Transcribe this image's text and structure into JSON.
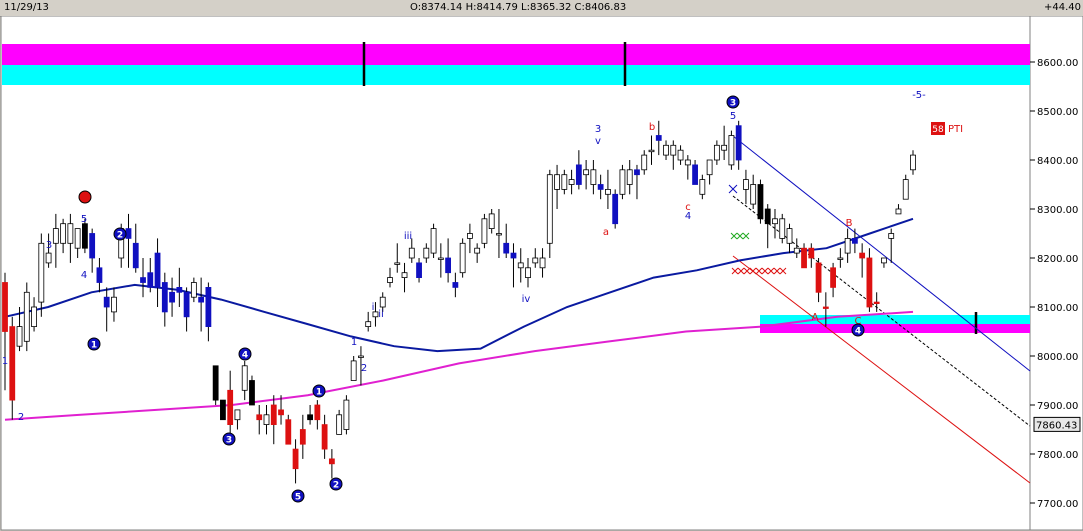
{
  "header": {
    "date": "11/29/13",
    "ohlc": "O:8374.14  H:8414.79  L:8365.32  C:8406.83",
    "change": "+44.40"
  },
  "chart_data": {
    "type": "candlestick",
    "ylim": [
      7680,
      8700
    ],
    "yticks": [
      8600,
      8500,
      8400,
      8300,
      8200,
      8100,
      8000,
      7900,
      7800,
      7700
    ],
    "ytick_labels": [
      "8600.00",
      "8500.00",
      "8400.00",
      "8300.00",
      "8200.00",
      "8100.00",
      "8000.00",
      "7900.00",
      "7800.00",
      "7700.00"
    ],
    "last_price_label": "7860.43",
    "indicator_label": "PTI",
    "indicator_value": "58",
    "colors": {
      "bull": "#ffffff",
      "bear_blue": "#1010c0",
      "bear_red": "#dd1111",
      "bear_black": "#000000",
      "ma_short": "#0a1aa0",
      "ma_long": "#e020d0",
      "band_magenta": "#ff00ff",
      "band_cyan": "#00ffff"
    },
    "candles": [
      [
        8150,
        8170,
        7930,
        8050,
        "r"
      ],
      [
        8060,
        8080,
        7870,
        7910,
        "r"
      ],
      [
        8060,
        8100,
        8010,
        8020,
        "w"
      ],
      [
        8030,
        8150,
        8010,
        8130,
        "w"
      ],
      [
        8060,
        8120,
        8050,
        8100,
        "w"
      ],
      [
        8110,
        8250,
        8080,
        8230,
        "w"
      ],
      [
        8190,
        8250,
        8180,
        8210,
        "w"
      ],
      [
        8230,
        8290,
        8180,
        8260,
        "w"
      ],
      [
        8230,
        8280,
        8210,
        8270,
        "w"
      ],
      [
        8230,
        8290,
        8190,
        8270,
        "w"
      ],
      [
        8220,
        8260,
        8200,
        8260,
        "w"
      ],
      [
        8270,
        8280,
        8210,
        8220,
        "k"
      ],
      [
        8250,
        8260,
        8170,
        8200,
        "b"
      ],
      [
        8180,
        8200,
        8130,
        8150,
        "b"
      ],
      [
        8120,
        8140,
        8050,
        8100,
        "b"
      ],
      [
        8090,
        8140,
        8070,
        8120,
        "w"
      ],
      [
        8200,
        8270,
        8180,
        8260,
        "w"
      ],
      [
        8260,
        8290,
        8180,
        8240,
        "b"
      ],
      [
        8230,
        8270,
        8170,
        8180,
        "b"
      ],
      [
        8160,
        8200,
        8120,
        8150,
        "b"
      ],
      [
        8140,
        8200,
        8130,
        8170,
        "b"
      ],
      [
        8210,
        8240,
        8100,
        8140,
        "b"
      ],
      [
        8150,
        8170,
        8060,
        8090,
        "b"
      ],
      [
        8110,
        8160,
        8080,
        8130,
        "b"
      ],
      [
        8130,
        8180,
        8100,
        8140,
        "b"
      ],
      [
        8130,
        8140,
        8050,
        8080,
        "b"
      ],
      [
        8120,
        8160,
        8110,
        8150,
        "w"
      ],
      [
        8110,
        8160,
        8050,
        8120,
        "b"
      ],
      [
        8140,
        8150,
        8030,
        8060,
        "b"
      ],
      [
        7980,
        7980,
        7900,
        7910,
        "k"
      ],
      [
        7870,
        7890,
        7900,
        7910,
        "k"
      ],
      [
        7930,
        7970,
        7830,
        7860,
        "r"
      ],
      [
        7870,
        7890,
        7850,
        7890,
        "w"
      ],
      [
        7930,
        7990,
        7910,
        7980,
        "w"
      ],
      [
        7950,
        7960,
        7900,
        7900,
        "k"
      ],
      [
        7880,
        7900,
        7840,
        7870,
        "r"
      ],
      [
        7860,
        7900,
        7840,
        7880,
        "w"
      ],
      [
        7900,
        7920,
        7820,
        7860,
        "r"
      ],
      [
        7890,
        7920,
        7860,
        7880,
        "r"
      ],
      [
        7870,
        7880,
        7820,
        7820,
        "r"
      ],
      [
        7810,
        7830,
        7740,
        7770,
        "r"
      ],
      [
        7820,
        7880,
        7790,
        7850,
        "r"
      ],
      [
        7870,
        7900,
        7860,
        7880,
        "k"
      ],
      [
        7900,
        7910,
        7850,
        7870,
        "r"
      ],
      [
        7860,
        7880,
        7790,
        7810,
        "r"
      ],
      [
        7780,
        7810,
        7750,
        7790,
        "r"
      ],
      [
        7840,
        7890,
        7840,
        7880,
        "w"
      ],
      [
        7850,
        7920,
        7840,
        7910,
        "w"
      ],
      [
        7950,
        8000,
        7960,
        7990,
        "w"
      ],
      [
        8000,
        8020,
        7940,
        8000,
        "w"
      ],
      [
        8060,
        8090,
        8050,
        8070,
        "w"
      ],
      [
        8080,
        8110,
        8060,
        8090,
        "w"
      ],
      [
        8100,
        8130,
        8090,
        8120,
        "w"
      ],
      [
        8150,
        8180,
        8140,
        8160,
        "w"
      ],
      [
        8190,
        8230,
        8170,
        8190,
        "w"
      ],
      [
        8170,
        8190,
        8130,
        8160,
        "w"
      ],
      [
        8200,
        8240,
        8190,
        8220,
        "w"
      ],
      [
        8190,
        8200,
        8150,
        8160,
        "b"
      ],
      [
        8200,
        8230,
        8190,
        8220,
        "w"
      ],
      [
        8210,
        8270,
        8200,
        8260,
        "w"
      ],
      [
        8200,
        8230,
        8160,
        8200,
        "w"
      ],
      [
        8200,
        8240,
        8150,
        8170,
        "b"
      ],
      [
        8140,
        8170,
        8120,
        8150,
        "b"
      ],
      [
        8170,
        8240,
        8160,
        8230,
        "w"
      ],
      [
        8250,
        8270,
        8210,
        8240,
        "w"
      ],
      [
        8210,
        8230,
        8190,
        8220,
        "w"
      ],
      [
        8230,
        8290,
        8220,
        8280,
        "w"
      ],
      [
        8290,
        8300,
        8250,
        8260,
        "w"
      ],
      [
        8250,
        8300,
        8200,
        8250,
        "w"
      ],
      [
        8230,
        8270,
        8200,
        8210,
        "b"
      ],
      [
        8210,
        8230,
        8140,
        8200,
        "b"
      ],
      [
        8190,
        8220,
        8150,
        8180,
        "w"
      ],
      [
        8180,
        8200,
        8140,
        8160,
        "w"
      ],
      [
        8190,
        8220,
        8180,
        8200,
        "w"
      ],
      [
        8180,
        8220,
        8160,
        8200,
        "w"
      ],
      [
        8230,
        8380,
        8200,
        8370,
        "w"
      ],
      [
        8370,
        8390,
        8300,
        8340,
        "w"
      ],
      [
        8340,
        8380,
        8330,
        8370,
        "w"
      ],
      [
        8350,
        8380,
        8330,
        8360,
        "w"
      ],
      [
        8390,
        8420,
        8340,
        8350,
        "b"
      ],
      [
        8380,
        8400,
        8340,
        8370,
        "w"
      ],
      [
        8380,
        8400,
        8330,
        8350,
        "w"
      ],
      [
        8350,
        8370,
        8320,
        8340,
        "b"
      ],
      [
        8340,
        8380,
        8300,
        8330,
        "w"
      ],
      [
        8330,
        8340,
        8260,
        8270,
        "b"
      ],
      [
        8330,
        8390,
        8320,
        8380,
        "w"
      ],
      [
        8380,
        8400,
        8330,
        8350,
        "w"
      ],
      [
        8370,
        8390,
        8320,
        8380,
        "b"
      ],
      [
        8380,
        8420,
        8370,
        8410,
        "w"
      ],
      [
        8420,
        8450,
        8390,
        8420,
        "w"
      ],
      [
        8440,
        8480,
        8410,
        8450,
        "b"
      ],
      [
        8430,
        8440,
        8400,
        8410,
        "w"
      ],
      [
        8410,
        8440,
        8380,
        8430,
        "w"
      ],
      [
        8420,
        8430,
        8390,
        8400,
        "w"
      ],
      [
        8390,
        8410,
        8360,
        8400,
        "w"
      ],
      [
        8390,
        8400,
        8350,
        8350,
        "b"
      ],
      [
        8330,
        8370,
        8320,
        8360,
        "w"
      ],
      [
        8370,
        8400,
        8350,
        8400,
        "w"
      ],
      [
        8400,
        8440,
        8390,
        8430,
        "w"
      ],
      [
        8430,
        8470,
        8400,
        8420,
        "w"
      ],
      [
        8390,
        8460,
        8380,
        8450,
        "w"
      ],
      [
        8470,
        8480,
        8380,
        8400,
        "b"
      ],
      [
        8360,
        8380,
        8310,
        8340,
        "w"
      ],
      [
        8350,
        8370,
        8300,
        8310,
        "w"
      ],
      [
        8350,
        8360,
        8270,
        8280,
        "k"
      ],
      [
        8300,
        8310,
        8220,
        8270,
        "k"
      ],
      [
        8280,
        8300,
        8240,
        8270,
        "w"
      ],
      [
        8280,
        8290,
        8230,
        8240,
        "w"
      ],
      [
        8260,
        8270,
        8210,
        8230,
        "w"
      ],
      [
        8220,
        8240,
        8200,
        8210,
        "w"
      ],
      [
        8220,
        8230,
        8180,
        8180,
        "r"
      ],
      [
        8200,
        8230,
        8180,
        8220,
        "r"
      ],
      [
        8190,
        8200,
        8110,
        8130,
        "r"
      ],
      [
        8100,
        8130,
        8060,
        8100,
        "r"
      ],
      [
        8180,
        8190,
        8120,
        8140,
        "r"
      ],
      [
        8200,
        8220,
        8180,
        8200,
        "w"
      ],
      [
        8210,
        8260,
        8190,
        8240,
        "w"
      ],
      [
        8240,
        8260,
        8210,
        8230,
        "b"
      ],
      [
        8210,
        8230,
        8160,
        8200,
        "r"
      ],
      [
        8200,
        8220,
        8090,
        8100,
        "r"
      ],
      [
        8110,
        8130,
        8090,
        8110,
        "r"
      ],
      [
        8190,
        8200,
        8180,
        8200,
        "w"
      ],
      [
        8240,
        8260,
        8190,
        8250,
        "w"
      ],
      [
        8290,
        8310,
        8290,
        8300,
        "w"
      ],
      [
        8320,
        8370,
        8320,
        8360,
        "w"
      ],
      [
        8380,
        8420,
        8370,
        8410,
        "w"
      ]
    ],
    "ma_short": [
      8080,
      8100,
      8130,
      8145,
      8135,
      8115,
      8090,
      8065,
      8040,
      8020,
      8010,
      8015,
      8060,
      8100,
      8130,
      8160,
      8175,
      8195,
      8210,
      8220,
      8250,
      8280
    ],
    "ma_long": [
      7870,
      7880,
      7890,
      7900,
      7920,
      7950,
      7985,
      8010,
      8030,
      8050,
      8060,
      8080,
      8090
    ],
    "wave_labels": [
      {
        "text": "1",
        "color": "blue",
        "circled": false
      },
      {
        "text": "2",
        "color": "blue",
        "circled": false
      },
      {
        "text": "3",
        "color": "blue",
        "circled": false
      },
      {
        "text": "5",
        "color": "blue",
        "circled": false
      },
      {
        "text": "4",
        "color": "blue",
        "circled": false
      },
      {
        "text": "2",
        "color": "blue",
        "circled": true
      },
      {
        "text": "1",
        "color": "blue",
        "circled": true
      },
      {
        "text": "4",
        "color": "blue",
        "circled": true
      },
      {
        "text": "3",
        "color": "blue",
        "circled": true
      },
      {
        "text": "5",
        "color": "blue",
        "circled": true
      },
      {
        "text": "1",
        "color": "blue",
        "circled": true
      },
      {
        "text": "2",
        "color": "blue",
        "circled": true
      },
      {
        "text": "1",
        "color": "blue",
        "circled": false
      },
      {
        "text": "2",
        "color": "blue",
        "circled": false
      },
      {
        "text": "i",
        "color": "blue",
        "circled": false
      },
      {
        "text": "ii",
        "color": "blue",
        "circled": false
      },
      {
        "text": "iii",
        "color": "blue",
        "circled": false
      },
      {
        "text": "iv",
        "color": "blue",
        "circled": false
      },
      {
        "text": "v",
        "color": "blue",
        "circled": false
      },
      {
        "text": "3",
        "color": "blue",
        "circled": false
      },
      {
        "text": "a",
        "color": "red",
        "circled": false
      },
      {
        "text": "b",
        "color": "red",
        "circled": false
      },
      {
        "text": "c",
        "color": "red",
        "circled": false
      },
      {
        "text": "4",
        "color": "blue",
        "circled": false
      },
      {
        "text": "3",
        "color": "blue",
        "circled": true
      },
      {
        "text": "5",
        "color": "blue",
        "circled": false
      },
      {
        "text": "-5-",
        "color": "blue",
        "circled": false
      },
      {
        "text": "B",
        "color": "red",
        "circled": false
      },
      {
        "text": "A",
        "color": "red",
        "circled": false
      },
      {
        "text": "C",
        "color": "red",
        "circled": false
      },
      {
        "text": "4",
        "color": "blue",
        "circled": true
      }
    ]
  }
}
